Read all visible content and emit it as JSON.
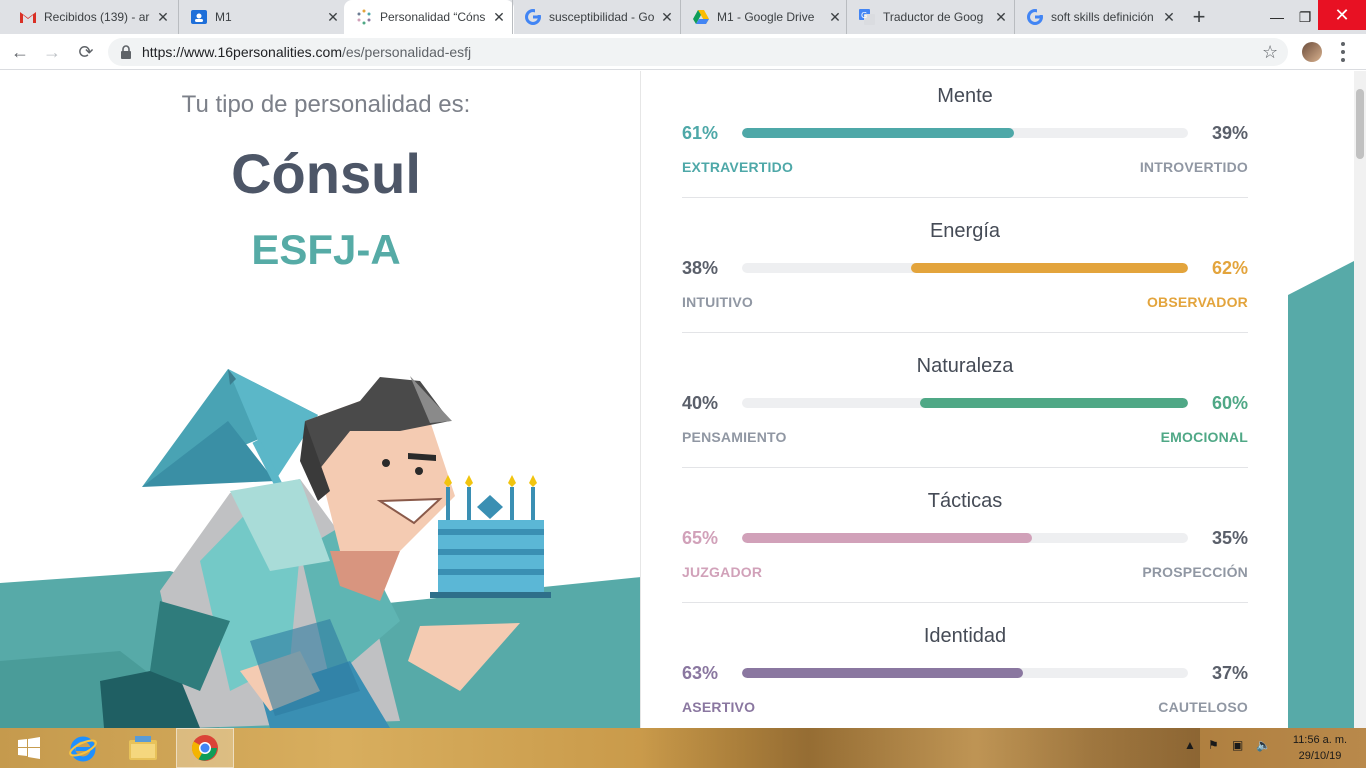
{
  "browser": {
    "tabs": [
      {
        "title": "Recibidos (139) - ar",
        "icon": "gmail-icon",
        "active": false
      },
      {
        "title": "M1",
        "icon": "classroom-icon",
        "active": false
      },
      {
        "title": "Personalidad “Cóns",
        "icon": "16personalities-icon",
        "active": true
      },
      {
        "title": "susceptibilidad - Go",
        "icon": "google-icon",
        "active": false
      },
      {
        "title": "M1 - Google Drive",
        "icon": "drive-icon",
        "active": false
      },
      {
        "title": "Traductor de Goog",
        "icon": "translate-icon",
        "active": false
      },
      {
        "title": "soft skills definición",
        "icon": "google-icon",
        "active": false
      }
    ],
    "new_tab_label": "+",
    "url_host": "https://www.16personalities.com",
    "url_path": "/es/personalidad-esfj"
  },
  "page": {
    "intro": "Tu tipo de personalidad es:",
    "type_name": "Cónsul",
    "type_code": "ESFJ-A",
    "traits": [
      {
        "heading": "Mente",
        "left_pct": "61%",
        "right_pct": "39%",
        "left_label": "EXTRAVERTIDO",
        "right_label": "INTROVERTIDO",
        "value": 0.61,
        "dominant": "left",
        "color": "#4ea8a8"
      },
      {
        "heading": "Energía",
        "left_pct": "38%",
        "right_pct": "62%",
        "left_label": "INTUITIVO",
        "right_label": "OBSERVADOR",
        "value": 0.62,
        "dominant": "right",
        "color": "#e3a43c"
      },
      {
        "heading": "Naturaleza",
        "left_pct": "40%",
        "right_pct": "60%",
        "left_label": "PENSAMIENTO",
        "right_label": "EMOCIONAL",
        "value": 0.6,
        "dominant": "right",
        "color": "#4fa886"
      },
      {
        "heading": "Tácticas",
        "left_pct": "65%",
        "right_pct": "35%",
        "left_label": "JUZGADOR",
        "right_label": "PROSPECCIÓN",
        "value": 0.65,
        "dominant": "left",
        "color": "#d1a1b9"
      },
      {
        "heading": "Identidad",
        "left_pct": "63%",
        "right_pct": "37%",
        "left_label": "ASERTIVO",
        "right_label": "CAUTELOSO",
        "value": 0.63,
        "dominant": "left",
        "color": "#8a77a0"
      }
    ]
  },
  "taskbar": {
    "time": "11:56 a. m.",
    "date": "29/10/19"
  },
  "colors": {
    "teal": "#56aba6",
    "heading": "#4d5667",
    "neutral_text": "#5a5f6a",
    "neutral_label": "#9097a3"
  }
}
